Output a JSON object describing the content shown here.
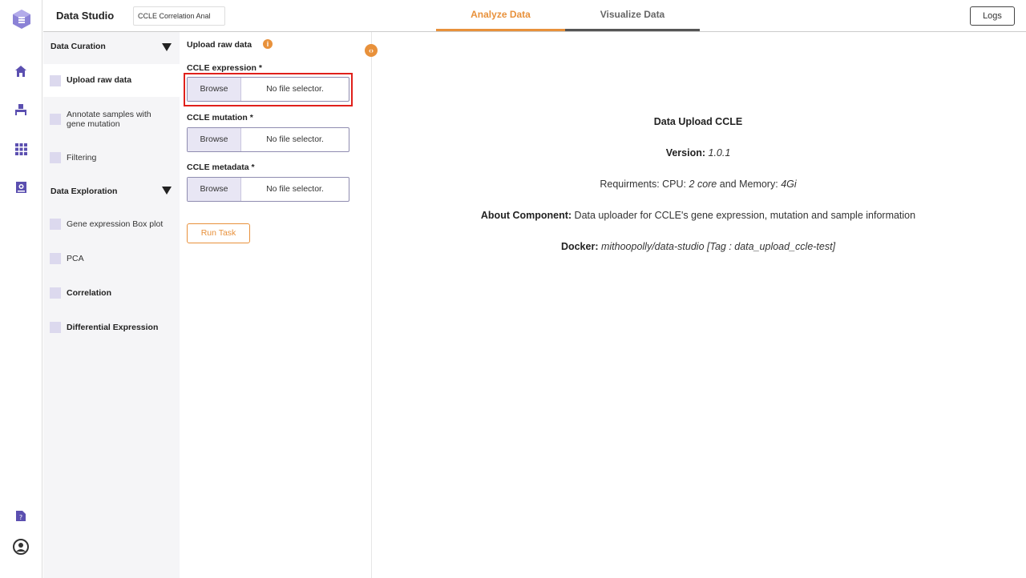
{
  "header": {
    "brand": "Data Studio",
    "project_name": "CCLE Correlation Anal",
    "tabs": [
      {
        "label": "Analyze Data",
        "active": true
      },
      {
        "label": "Visualize Data",
        "active": false
      }
    ],
    "logs_label": "Logs"
  },
  "rail": {
    "icons": [
      "logo-icon",
      "home-icon",
      "workspace-icon",
      "apps-grid-icon",
      "report-icon",
      "help-doc-icon",
      "user-account-icon"
    ]
  },
  "steps": {
    "sections": [
      {
        "title": "Data Curation",
        "items": [
          {
            "label": "Upload raw data",
            "active": true
          },
          {
            "label": "Annotate samples with gene mutation"
          },
          {
            "label": "Filtering"
          }
        ]
      },
      {
        "title": "Data Exploration",
        "items": [
          {
            "label": "Gene expression Box plot"
          },
          {
            "label": "PCA"
          },
          {
            "label": "Correlation"
          },
          {
            "label": "Differential Expression"
          }
        ]
      }
    ]
  },
  "form": {
    "title": "Upload raw data",
    "info_glyph": "i",
    "fields": [
      {
        "label": "CCLE expression *",
        "browse": "Browse",
        "file": "No file selector."
      },
      {
        "label": "CCLE mutation *",
        "browse": "Browse",
        "file": "No file selector."
      },
      {
        "label": "CCLE metadata *",
        "browse": "Browse",
        "file": "No file selector."
      }
    ],
    "run_label": "Run Task"
  },
  "info": {
    "title": "Data Upload CCLE",
    "version_label": "Version:",
    "version": "1.0.1",
    "req_prefix": "Requirments: CPU:",
    "cpu": "2 core",
    "req_mid": "and Memory:",
    "memory": "4Gi",
    "about_label": "About Component:",
    "about_text": "Data uploader for CCLE's gene expression, mutation and sample information",
    "docker_label": "Docker:",
    "docker_text": "mithoopolly/data-studio [Tag : data_upload_ccle-test]"
  },
  "colors": {
    "accent": "#e8913b",
    "brand_purple": "#6a5ec4",
    "highlight": "#e0201b"
  }
}
